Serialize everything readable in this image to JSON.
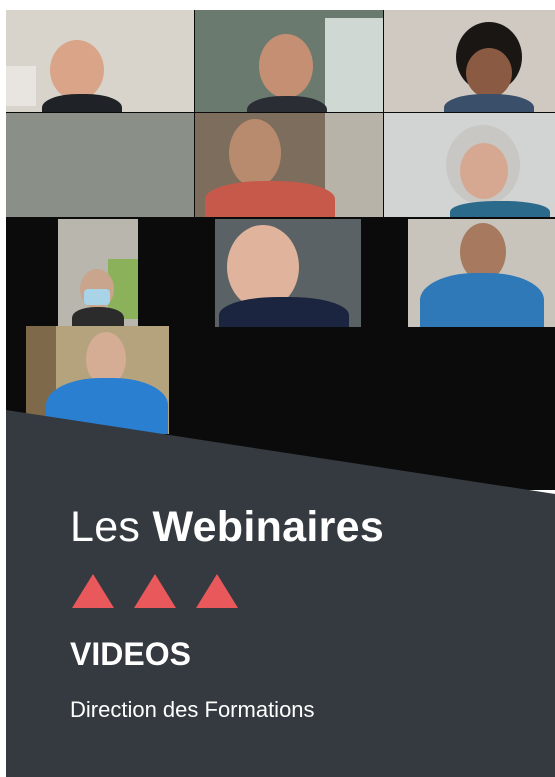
{
  "header": {
    "title_prefix": "Les",
    "title_strong": "Webinaires"
  },
  "section_label": "VIDEOS",
  "organization": "Direction des Formations",
  "colors": {
    "panel": "#343a3f",
    "accent": "#e9585a",
    "text": "#ffffff"
  },
  "decor": {
    "triangles": 3
  },
  "video_call": {
    "participants": 10
  }
}
